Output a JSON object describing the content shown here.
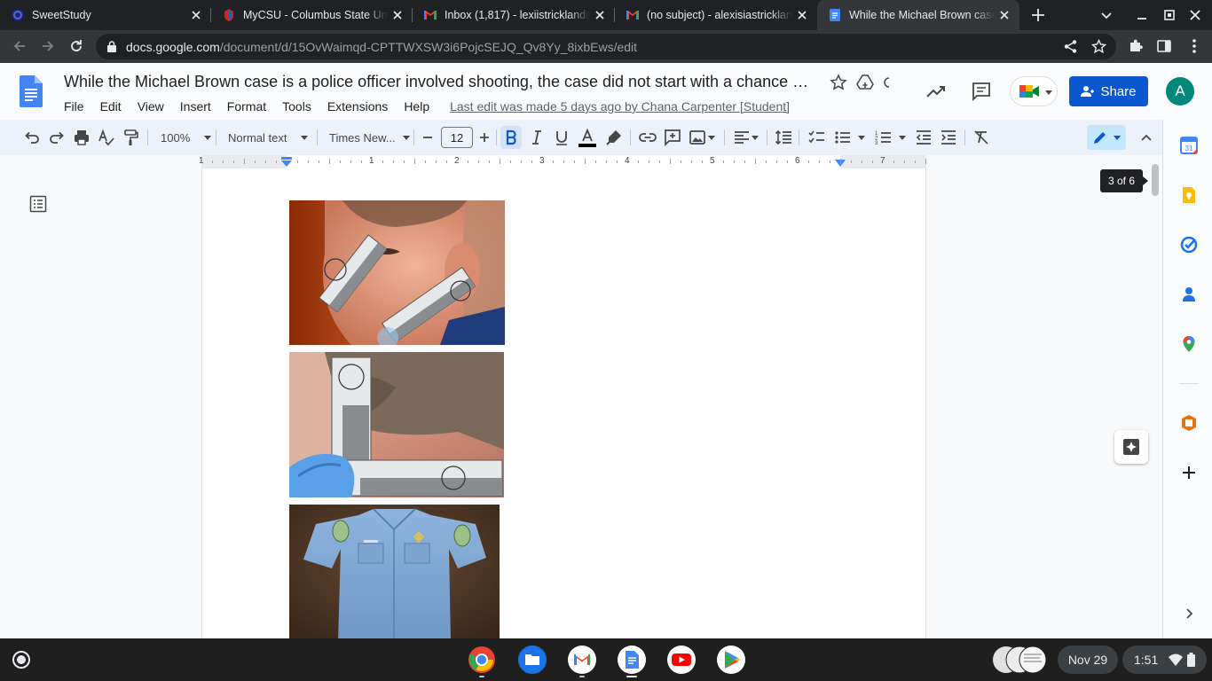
{
  "browser": {
    "tabs": [
      {
        "title": "SweetStudy",
        "active": false
      },
      {
        "title": "MyCSU - Columbus State Univ",
        "active": false
      },
      {
        "title": "Inbox (1,817) - lexiistrickland@",
        "active": false
      },
      {
        "title": "(no subject) - alexisiastrickland",
        "active": false
      },
      {
        "title": "While the Michael Brown case",
        "active": true
      }
    ],
    "url_host": "docs.google.com",
    "url_path": "/document/d/15OvWaimqd-CPTTWXSW3i6PojcSEJQ_Qv8Yy_8ixbEws/edit"
  },
  "docs": {
    "title": "While the Michael Brown case is a police officer involved shooting, the case did not start with a chance …",
    "menu": [
      "File",
      "Edit",
      "View",
      "Insert",
      "Format",
      "Tools",
      "Extensions",
      "Help"
    ],
    "last_edit": "Last edit was made 5 days ago by Chana Carpenter [Student]",
    "share_label": "Share",
    "avatar_letter": "A",
    "accent": "#0b57d0"
  },
  "toolbar": {
    "zoom": "100%",
    "style": "Normal text",
    "font": "Times New...",
    "font_size": "12",
    "minus": "−",
    "plus": "+"
  },
  "ruler": {
    "numbers": [
      "1",
      "1",
      "2",
      "3",
      "4",
      "5",
      "6",
      "7"
    ]
  },
  "canvas": {
    "page_indicator": "3 of 6",
    "images": [
      "face-with-forensic-scale-photo",
      "neck-with-forensic-scale-photo",
      "uniform-shirt-photo"
    ]
  },
  "shelf": {
    "apps": [
      "chrome",
      "files",
      "gmail",
      "docs",
      "youtube",
      "play-store"
    ],
    "date": "Nov 29",
    "time": "1:51"
  }
}
